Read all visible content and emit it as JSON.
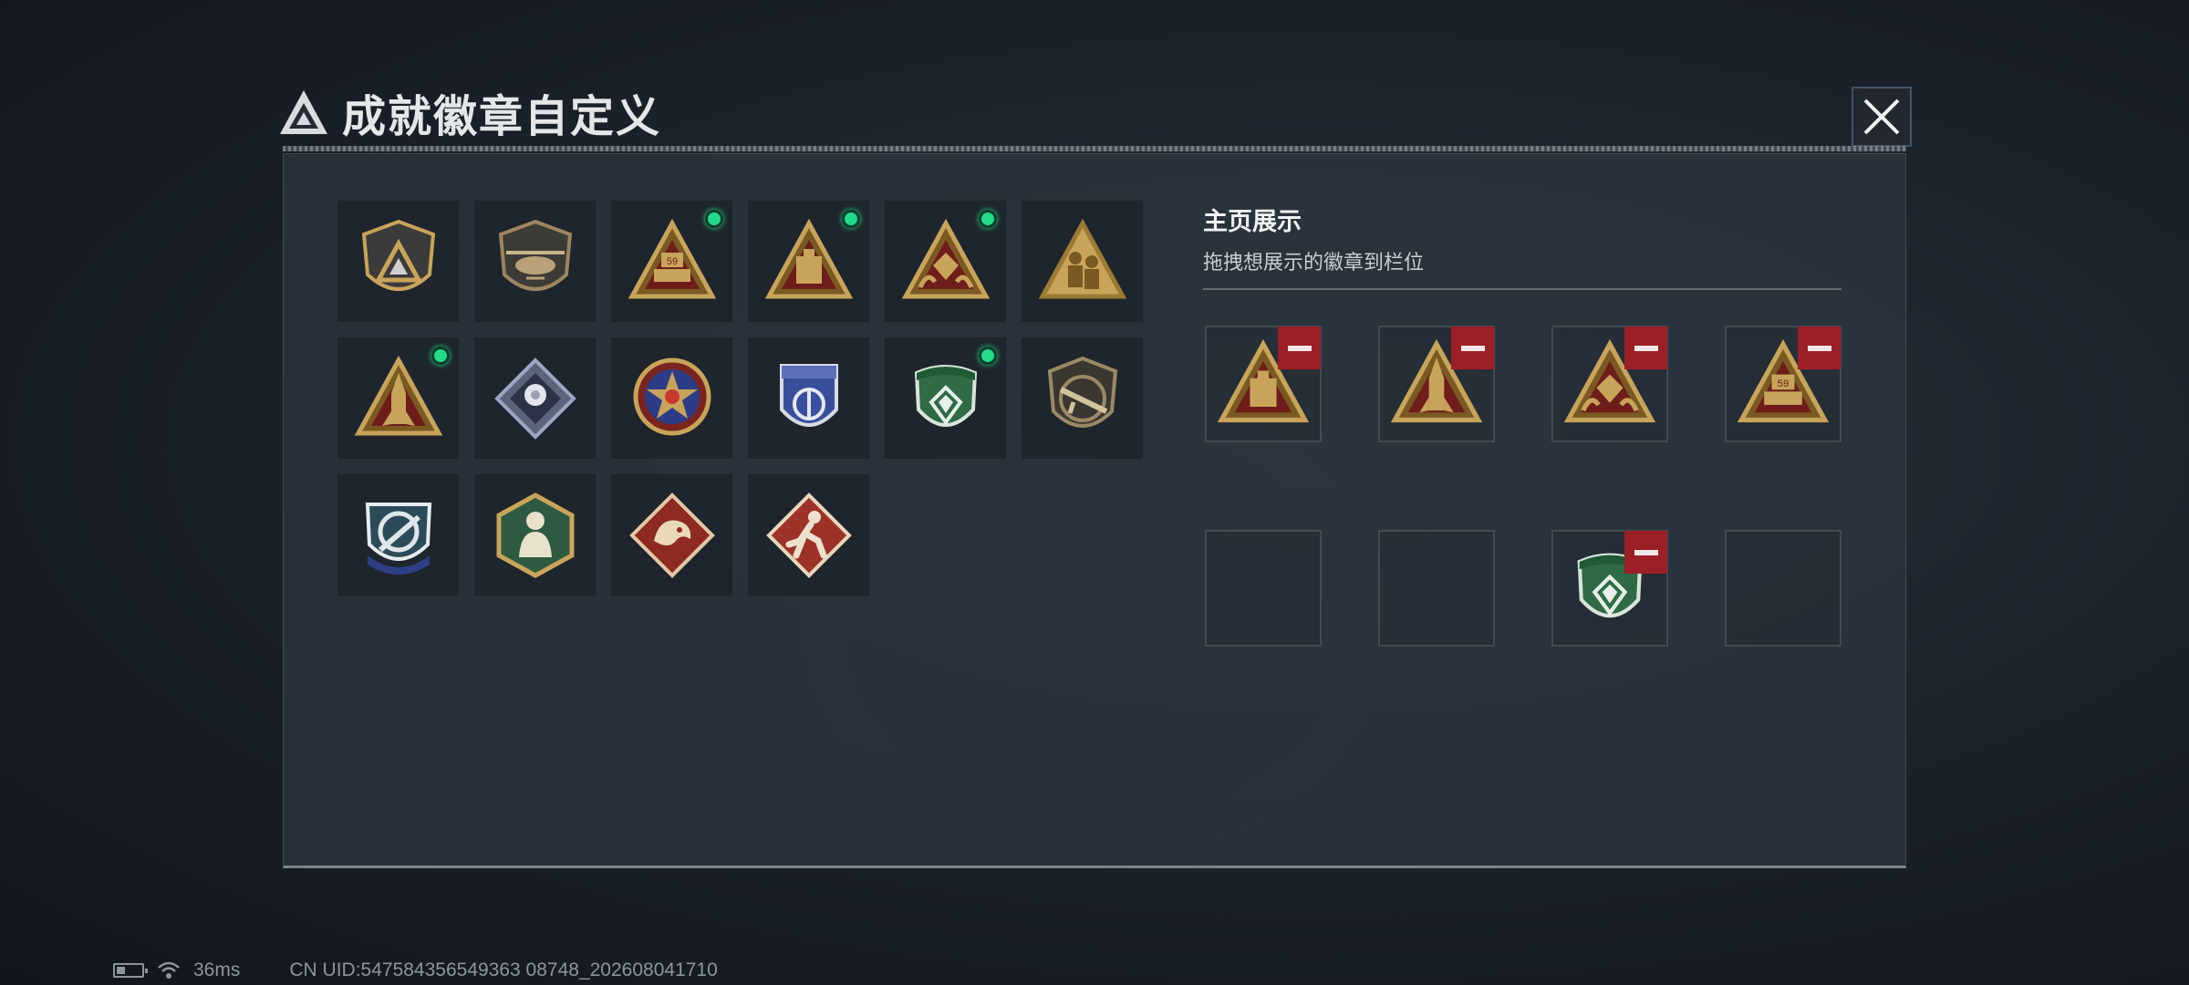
{
  "title": "成就徽章自定义",
  "icons": {
    "title_logo": "triangle-logo-icon",
    "close": "close-icon"
  },
  "colors": {
    "gold": "#c8a45a",
    "equipped_dot": "#23d98a",
    "remove": "#9b1f26"
  },
  "badges": [
    {
      "icon": "shield-triangle-badge",
      "equipped": false
    },
    {
      "icon": "helicopter-badge",
      "equipped": false
    },
    {
      "icon": "soldier-59-triangle-badge",
      "equipped": true
    },
    {
      "icon": "bunker-triangle-badge",
      "equipped": true
    },
    {
      "icon": "gem-triangle-badge",
      "equipped": true
    },
    {
      "icon": "soldiers-triangle-badge",
      "equipped": false
    },
    {
      "icon": "missile-triangle-badge",
      "equipped": true
    },
    {
      "icon": "rose-diamond-badge",
      "equipped": false
    },
    {
      "icon": "star-medal-badge",
      "equipped": false
    },
    {
      "icon": "blue-shield-badge",
      "equipped": false
    },
    {
      "icon": "green-gem-shield-badge",
      "equipped": true
    },
    {
      "icon": "rifle-shield-badge",
      "equipped": false
    },
    {
      "icon": "crosshair-shield-badge",
      "equipped": false
    },
    {
      "icon": "hexagon-figure-badge",
      "equipped": false
    },
    {
      "icon": "dragon-diamond-badge",
      "equipped": false
    },
    {
      "icon": "runner-diamond-badge",
      "equipped": false
    }
  ],
  "display": {
    "title": "主页展示",
    "subtitle": "拖拽想展示的徽章到栏位",
    "slots": [
      {
        "badge": "bunker-triangle-badge",
        "removable": true
      },
      {
        "badge": "missile-triangle-badge",
        "removable": true
      },
      {
        "badge": "gem-triangle-badge",
        "removable": true
      },
      {
        "badge": "soldier-59-triangle-badge",
        "removable": true
      },
      {
        "badge": null,
        "removable": false
      },
      {
        "badge": null,
        "removable": false
      },
      {
        "badge": "green-gem-shield-badge",
        "removable": true
      },
      {
        "badge": null,
        "removable": false
      }
    ]
  },
  "footer": {
    "battery_icon": "battery-icon",
    "wifi_icon": "wifi-icon",
    "ping": "36ms",
    "uid": "CN UID:547584356549363 08748_202608041710"
  }
}
